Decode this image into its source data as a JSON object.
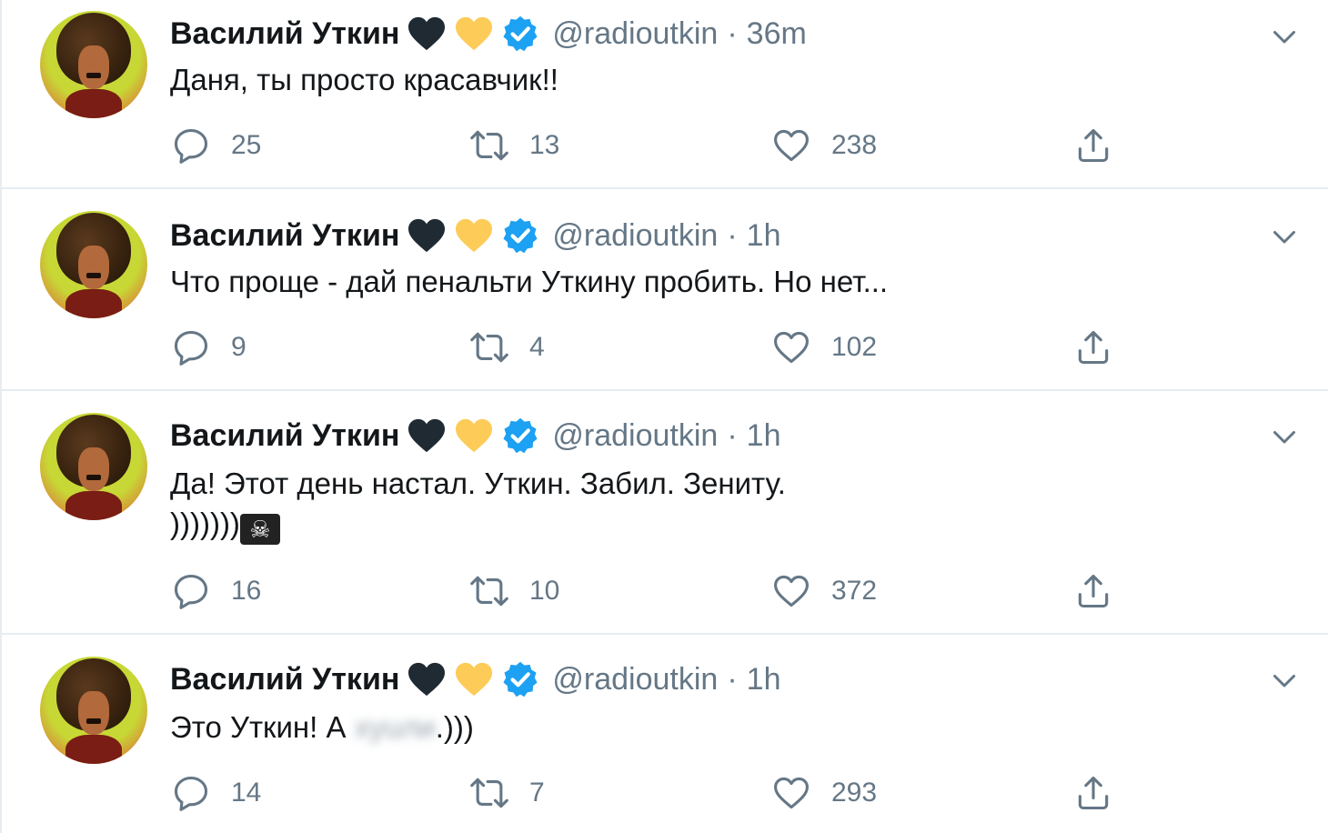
{
  "colors": {
    "icon_gray": "#657786",
    "verified_blue": "#1da1f2",
    "heart_black": "#1f2a33",
    "heart_yellow": "#fdcb58",
    "divider": "#e6ecf0"
  },
  "tweets": [
    {
      "author_name": "Василий Уткин",
      "handle": "@radioutkin",
      "separator": "·",
      "time": "36m",
      "text_lines": [
        "Даня, ты просто красавчик!!"
      ],
      "replies": "25",
      "retweets": "13",
      "likes": "238"
    },
    {
      "author_name": "Василий Уткин",
      "handle": "@radioutkin",
      "separator": "·",
      "time": "1h",
      "text_lines": [
        "Что проще - дай пенальти Уткину пробить. Но нет..."
      ],
      "replies": "9",
      "retweets": "4",
      "likes": "102"
    },
    {
      "author_name": "Василий Уткин",
      "handle": "@radioutkin",
      "separator": "·",
      "time": "1h",
      "text_lines": [
        "Да! Этот день настал. Уткин. Забил. Зениту.",
        ")))))))"
      ],
      "emoji": "☠",
      "replies": "16",
      "retweets": "10",
      "likes": "372"
    },
    {
      "author_name": "Василий Уткин",
      "handle": "@radioutkin",
      "separator": "·",
      "time": "1h",
      "text_before_blur": "Это Уткин! А ",
      "blurred_text": "xyuли",
      "text_after_blur": ".)))",
      "replies": "14",
      "retweets": "7",
      "likes": "293"
    }
  ],
  "icons": {
    "reply": "reply-bubble-icon",
    "retweet": "retweet-icon",
    "like": "heart-outline-icon",
    "share": "share-upload-icon",
    "caret": "chevron-down-icon",
    "verified": "verified-badge-icon"
  }
}
